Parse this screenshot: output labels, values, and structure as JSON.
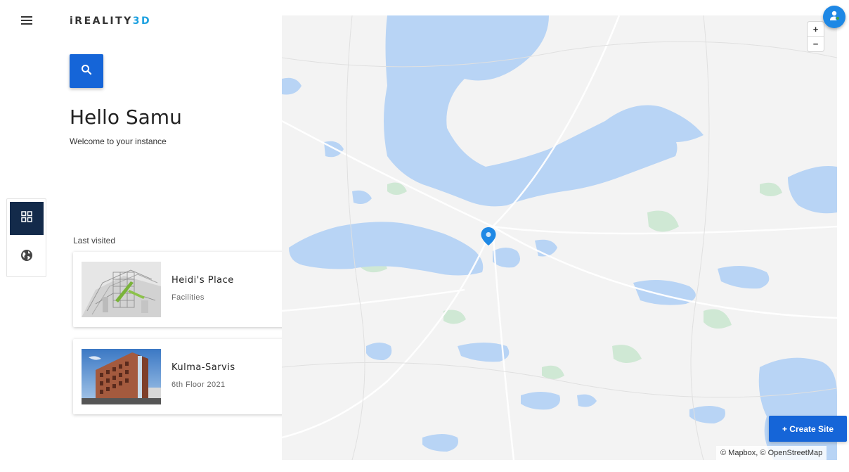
{
  "header": {
    "logo_main": "iREALITY",
    "logo_accent": "3D",
    "menu_icon": "hamburger-menu-icon",
    "search_icon": "search-icon",
    "avatar_icon": "user-avatar-icon"
  },
  "greeting": {
    "title": "Hello Samu",
    "subtitle": "Welcome to your instance"
  },
  "rail": {
    "items": [
      {
        "icon": "dashboard-grid-icon",
        "active": true
      },
      {
        "icon": "globe-icon",
        "active": false
      }
    ]
  },
  "last_visited": {
    "label": "Last visited",
    "sites": [
      {
        "title": "Heidi's Place",
        "subtitle": "Facilities",
        "more_icon": "more-horizontal-icon"
      },
      {
        "title": "Kulma-Sarvis",
        "subtitle": "6th Floor 2021",
        "more_icon": "more-horizontal-icon"
      }
    ]
  },
  "map": {
    "zoom_in": "+",
    "zoom_out": "−",
    "attribution": "© Mapbox, © OpenStreetMap",
    "marker_icon": "location-pin-icon"
  },
  "actions": {
    "create_site": "+ Create Site"
  },
  "colors": {
    "primary": "#1565d8",
    "rail_active": "#132a4a",
    "water": "#b8d4f5",
    "land": "#f3f3f3",
    "park": "#cfe8d4",
    "logo_accent": "#1da1e0"
  }
}
